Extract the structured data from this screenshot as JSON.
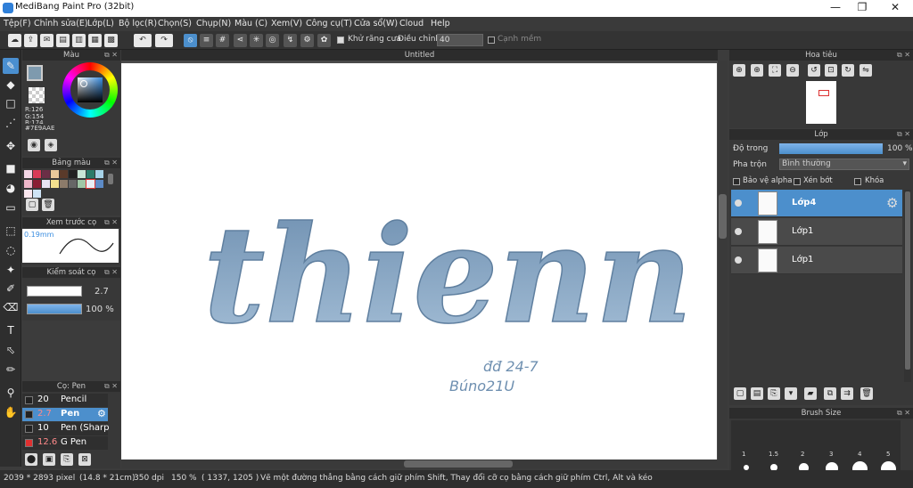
{
  "window": {
    "title": "MediBang Paint Pro (32bit)",
    "min": "—",
    "max": "❐",
    "close": "✕"
  },
  "menu": [
    "Tệp(F)",
    "Chỉnh sửa(E)",
    "Lớp(L)",
    "Bộ lọc(R)",
    "Chọn(S)",
    "Chụp(N)",
    "Màu (C)",
    "Xem(V)",
    "Công cụ(T)",
    "Cửa sổ(W)",
    "Cloud",
    "Help"
  ],
  "toolbar": {
    "antialias_label": "Khử răng cưa",
    "adjust_label": "Điều chỉnh",
    "adjust_value": "40",
    "smooth_label": "Cạnh mềm"
  },
  "panels": {
    "color": {
      "title": "Màu",
      "r": "R:126",
      "g": "G:154",
      "b": "B:174",
      "hex": "#7E9AAE",
      "primary": "#7e9aae"
    },
    "palette": {
      "title": "Bảng màu"
    },
    "brush_preview": {
      "title": "Xem trước cọ",
      "size": "0.19mm"
    },
    "brush_control": {
      "title": "Kiểm soát cọ",
      "size_value": "2.7",
      "opacity_value": "100 %"
    },
    "brushes": {
      "title": "Cọ: Pen",
      "items": [
        {
          "size": "20",
          "name": "Pencil",
          "color": "#222222"
        },
        {
          "size": "2.7",
          "name": "Pen",
          "color": "#222222"
        },
        {
          "size": "10",
          "name": "Pen (Sharp",
          "color": "#222222"
        },
        {
          "size": "12.6",
          "name": "G Pen",
          "color": "#e03030"
        }
      ]
    },
    "navigator": {
      "title": "Hoa tiêu"
    },
    "layer": {
      "title": "Lớp",
      "opacity_label": "Độ trong",
      "opacity_value": "100 %",
      "blend_label": "Pha trộn",
      "blend_value": "Bình thường",
      "protect_alpha": "Bảo vệ alpha",
      "clip": "Xén bớt",
      "lock": "Khóa",
      "items": [
        {
          "name": "Lớp4"
        },
        {
          "name": "Lớp1"
        },
        {
          "name": "Lớp1"
        }
      ]
    },
    "brush_size": {
      "title": "Brush Size",
      "labels": [
        "1",
        "1.5",
        "2",
        "3",
        "4",
        "5"
      ]
    }
  },
  "canvas": {
    "title": "Untitled",
    "text_main": "thienn",
    "text_sign1": "đđ 24-7",
    "text_sign2": "Búno21U"
  },
  "status": {
    "dimensions": "2039 * 2893 pixel",
    "physical": "(14.8 * 21cm)",
    "dpi": "350 dpi",
    "zoom": "150 %",
    "coords": "( 1337, 1205 )",
    "hint": "Vẽ một đường thẳng bằng cách giữ phím Shift, Thay đổi cỡ cọ bằng cách giữ phím Ctrl, Alt và kéo"
  },
  "colors": {
    "accent": "#4c8fcc",
    "canvas_text": "#7e9aae"
  }
}
